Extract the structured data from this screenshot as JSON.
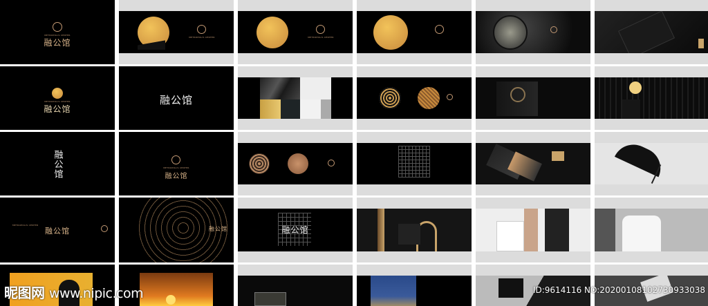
{
  "brand": {
    "name_cn": "融公馆",
    "name_en": "METROPOLIS CENTER"
  },
  "watermark": {
    "site_cn": "昵图网",
    "site_url": "www.nipic.com"
  },
  "image_id": "ID:9614116 NO:20200108102730933038",
  "colors": {
    "gold": "#d9b48a",
    "frame": "#dcdcdc",
    "background": "#000000"
  }
}
